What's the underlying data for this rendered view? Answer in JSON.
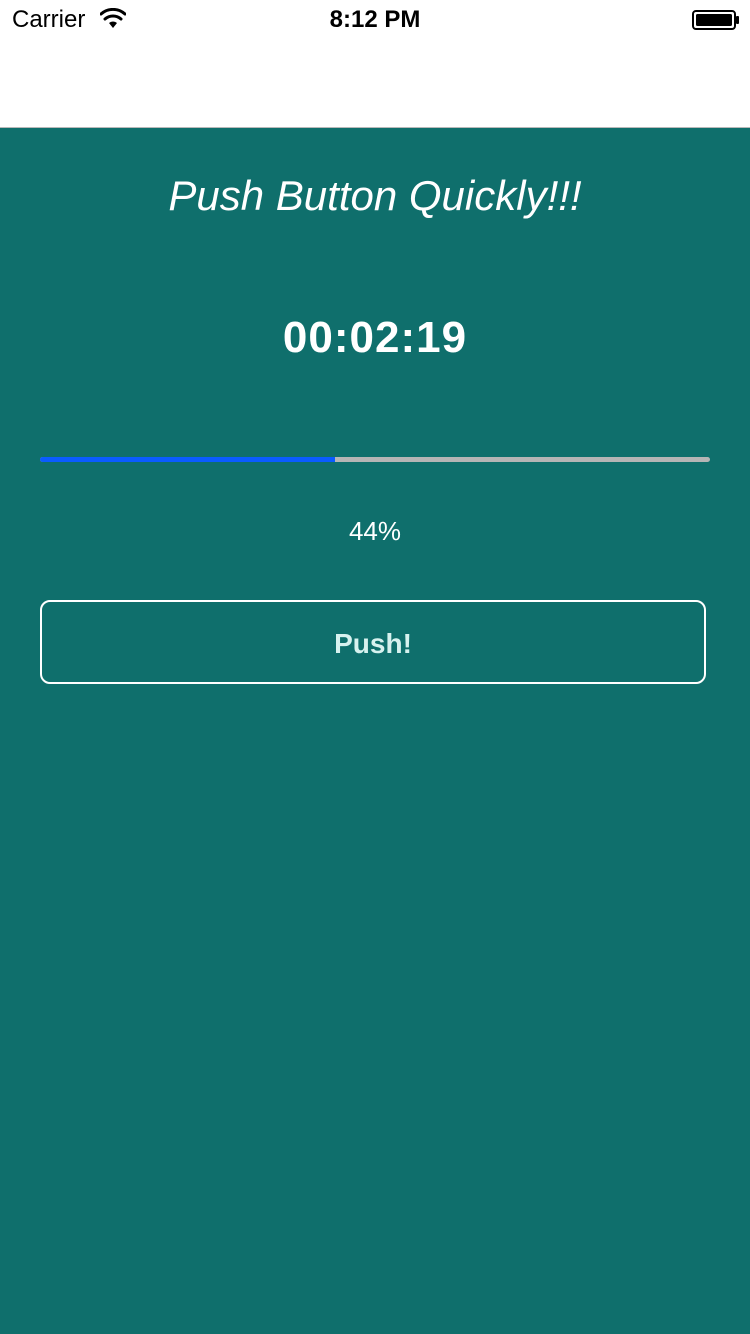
{
  "status_bar": {
    "carrier": "Carrier",
    "time": "8:12 PM",
    "wifi_icon": "wifi-icon",
    "battery_icon": "battery-icon"
  },
  "screen": {
    "title": "Push Button Quickly!!!",
    "timer": "00:02:19",
    "progress": {
      "value_percent": 44,
      "fill_color": "#0a5cff",
      "track_color": "#b5b5b5"
    },
    "percent_label": "44%",
    "button_label": "Push!"
  },
  "colors": {
    "background": "#0f6f6c",
    "text": "#ffffff",
    "button_border": "#ffffff"
  }
}
